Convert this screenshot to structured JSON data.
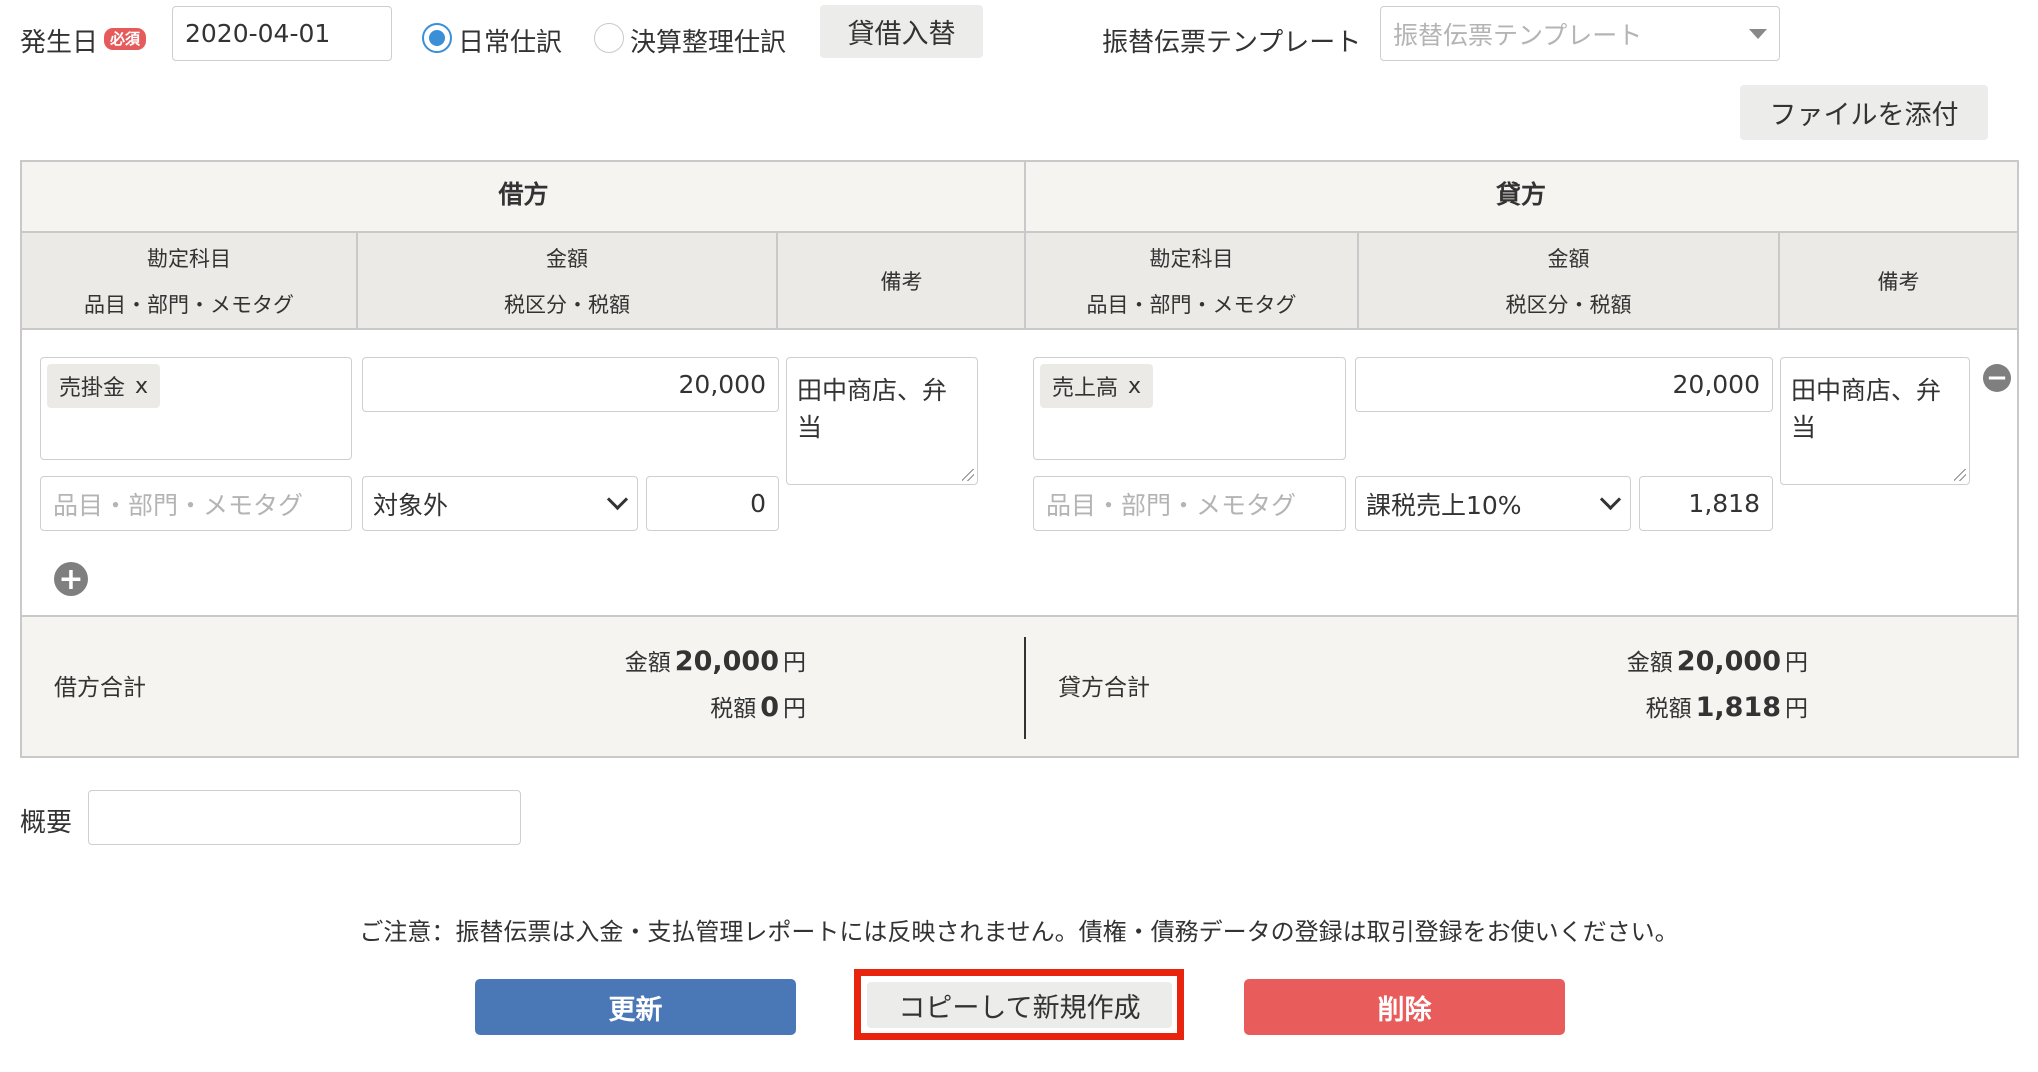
{
  "header": {
    "date_label": "発生日",
    "required_badge": "必須",
    "date_value": "2020-04-01",
    "radio_normal": "日常仕訳",
    "radio_settlement": "決算整理仕訳",
    "swap_button": "貸借入替",
    "template_label": "振替伝票テンプレート",
    "template_placeholder": "振替伝票テンプレート",
    "attach_button": "ファイルを添付"
  },
  "table": {
    "debit_title": "借方",
    "credit_title": "貸方",
    "col_account_line1": "勘定科目",
    "col_account_line2": "品目・部門・メモタグ",
    "col_amount_line1": "金額",
    "col_amount_line2": "税区分・税額",
    "col_note": "備考",
    "tag_placeholder": "品目・部門・メモタグ",
    "debit_row": {
      "account_tag": "売掛金",
      "remove_x": "x",
      "amount": "20,000",
      "note": "田中商店、弁当",
      "tax_category": "対象外",
      "tax_amount": "0"
    },
    "credit_row": {
      "account_tag": "売上高",
      "remove_x": "x",
      "amount": "20,000",
      "note": "田中商店、弁当",
      "tax_category": "課税売上10%",
      "tax_amount": "1,818"
    }
  },
  "totals": {
    "debit_label": "借方合計",
    "credit_label": "貸方合計",
    "amount_label": "金額",
    "tax_label": "税額",
    "yen": "円",
    "debit_amount": "20,000",
    "debit_tax": "0",
    "credit_amount": "20,000",
    "credit_tax": "1,818"
  },
  "summary_label": "概要",
  "notice": "ご注意：振替伝票は入金・支払管理レポートには反映されません。債権・債務データの登録は取引登録をお使いください。",
  "buttons": {
    "update": "更新",
    "copy": "コピーして新規作成",
    "delete": "削除"
  },
  "colors": {
    "update": "#4a77b5",
    "delete": "#e85c5c",
    "highlight": "#e8230e",
    "radio_accent": "#3a8fd6"
  }
}
